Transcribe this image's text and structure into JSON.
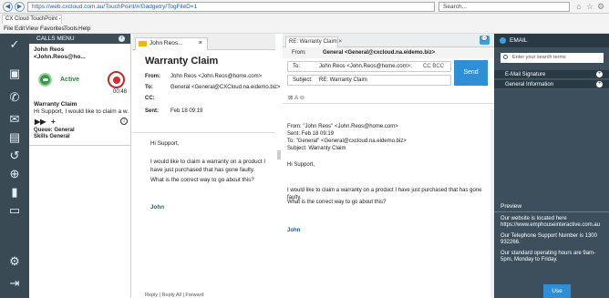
{
  "browser": {
    "url": "https://web.cxcloud.com.au/TouchPoint/#/Gadgetry/TogFileD=1",
    "search_placeholder": "Search...",
    "tab_title": "CX Cloud TouchPoint - Ac...",
    "menu": [
      "File",
      "Edit",
      "View",
      "Favorites",
      "Tools",
      "Help"
    ]
  },
  "calls": {
    "header": "CALLS MENU",
    "caller": "John Reos",
    "caller_email": "<John.Reos@ho...",
    "status": "Active",
    "timer": "00:48",
    "subject": "Warranty Claim",
    "preview": "Hi Support, I would like to claim a w...",
    "queue": "Queue: General",
    "skills": "Skills General"
  },
  "mail": {
    "tab": "John Reos...",
    "title": "Warranty Claim",
    "from_k": "From:",
    "from": "John Reos <John.Reos@home.com>",
    "to_k": "To:",
    "to": "General <General@CXCloud.na.eidemo.biz>",
    "cc_k": "CC:",
    "cc": "",
    "sent_k": "Sent:",
    "sent": "Feb 18 09:19",
    "greeting": "Hi Support,",
    "line1": "I would like to claim a warranty on a product I have just purchased that has gone faulty.",
    "line2": "What is the correct way to go about this?",
    "sign": "John",
    "reply_links": "Reply | Reply All | Forward"
  },
  "reply": {
    "tab": "RE: Warranty Claim",
    "from_k": "From:",
    "from": "General <General@cxcloud.na.eidemo.biz>",
    "to_k": "To:",
    "to": "John Reos <John.Reos@home.com>;",
    "cc": "CC BCC",
    "subject_k": "Subject:",
    "subject": "RE: Warranty Claim",
    "send": "Send",
    "toolbar": "⊠  A  ⊖",
    "q_from": "From: \"John Reos\" <John.Reos@home.com>",
    "q_sent": "Sent: Feb 18 09:19",
    "q_to": "To: \"General\" <General@cxcloud.na.eidemo.biz>",
    "q_subject": "Subject: Warranty Claim",
    "q_greeting": "Hi Support,",
    "q_line1": "I would like to claim a warranty on a product I have just purchased that has gone faulty.",
    "q_line2": "What is the correct way to go about this?",
    "q_sign": "John"
  },
  "email_panel": {
    "header": "EMAIL",
    "search_placeholder": "Enter your search terms",
    "rows": [
      "E-Mail Signature",
      "General Information"
    ],
    "preview_head": "Preview",
    "p1": "Our website is located here https://www.emphouseinteractive.com.au",
    "p2": "Our Telephone Support Number is 1300 932266.",
    "p3": "Our standard operating hours are 9am-5pm, Monday to Friday.",
    "use": "Use"
  },
  "colors": {
    "rail": "#3a4a55",
    "accent_blue": "#2f8fd6",
    "active_green": "#3a9b45",
    "decline_red": "#d32f2f",
    "email_panel_bg": "#3d4f5c"
  }
}
